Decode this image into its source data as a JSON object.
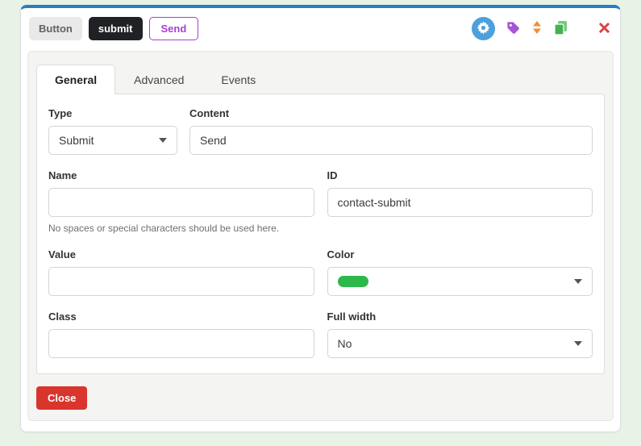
{
  "toolbar": {
    "element_type_badge": "Button",
    "element_name_badge": "submit",
    "preview_button_label": "Send",
    "icons": [
      {
        "name": "gear-icon",
        "color": "#4ba0dd"
      },
      {
        "name": "tag-icon",
        "color": "#a556d6"
      },
      {
        "name": "sort-arrows-icon",
        "color": "#ef8f3a"
      },
      {
        "name": "duplicate-icon",
        "color": "#45b050"
      },
      {
        "name": "close-x-icon",
        "color": "#d64541"
      }
    ]
  },
  "tabs": [
    {
      "label": "General",
      "active": true
    },
    {
      "label": "Advanced",
      "active": false
    },
    {
      "label": "Events",
      "active": false
    }
  ],
  "form": {
    "type": {
      "label": "Type",
      "value": "Submit"
    },
    "content": {
      "label": "Content",
      "value": "Send"
    },
    "name": {
      "label": "Name",
      "value": "",
      "helper": "No spaces or special characters should be used here."
    },
    "id": {
      "label": "ID",
      "value": "contact-submit"
    },
    "value": {
      "label": "Value",
      "value": ""
    },
    "color": {
      "label": "Color",
      "swatch_color": "#2db84c"
    },
    "class": {
      "label": "Class",
      "value": ""
    },
    "full_width": {
      "label": "Full width",
      "value": "No"
    }
  },
  "footer": {
    "close_label": "Close"
  },
  "colors": {
    "page_background": "#e8f3e6",
    "card_top_border": "#2b7cc2",
    "preview_button_accent": "#a93fd3",
    "close_button": "#d9352c"
  }
}
